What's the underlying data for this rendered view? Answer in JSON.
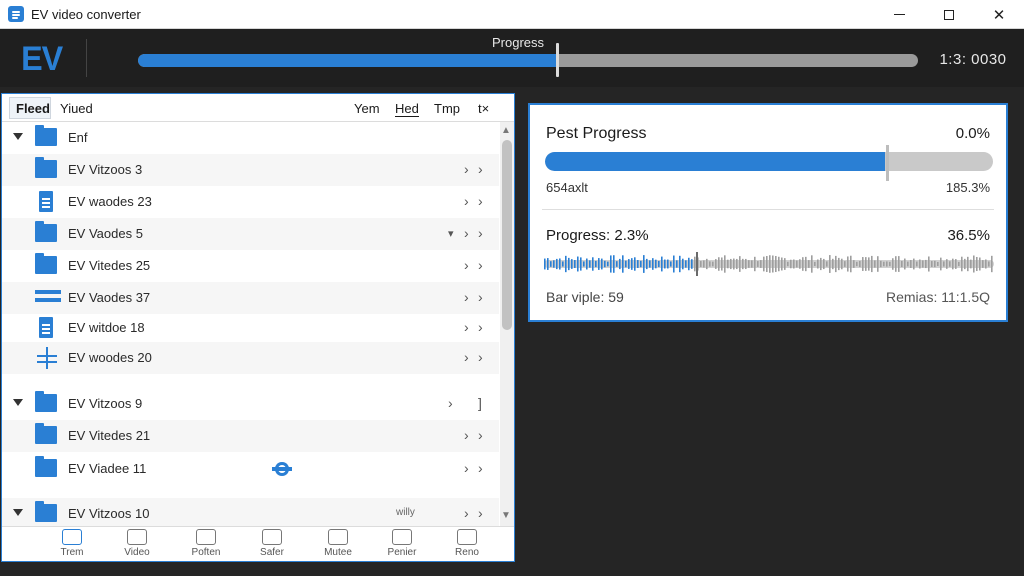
{
  "window": {
    "title": "EV video converter",
    "close_glyph": "✕"
  },
  "header": {
    "logo": "EV",
    "progress_label": "Progress",
    "progress_fraction": 0.537,
    "time_readout": "1:3: 0030"
  },
  "left_panel": {
    "tabs": [
      {
        "label": "Fleed",
        "active": true
      },
      {
        "label": "Yiued",
        "active": false
      }
    ],
    "columns": [
      "Yem",
      "Hed",
      "Tmp",
      "t×"
    ],
    "rows": [
      {
        "label": "Enf",
        "icon": "folder-icon",
        "expanded": true
      },
      {
        "label": "EV Vitzoos 3",
        "icon": "folder-icon"
      },
      {
        "label": "EV waodes 23",
        "icon": "document-icon"
      },
      {
        "label": "EV Vaodes 5",
        "icon": "folder-icon",
        "extra": "▾"
      },
      {
        "label": "EV Vitedes 25",
        "icon": "folder-icon"
      },
      {
        "label": "EV Vaodes 37",
        "icon": "bars-icon"
      },
      {
        "label": "EV witdoe 18",
        "icon": "document-icon"
      },
      {
        "label": "EV woodes 20",
        "icon": "cross-icon"
      },
      {
        "label": "EV Vitzoos 9",
        "icon": "folder-icon",
        "expanded": true
      },
      {
        "label": "EV Vitedes 21",
        "icon": "folder-icon"
      },
      {
        "label": "EV Viadee 11",
        "icon": "folder-icon",
        "badge": "gear-icon"
      },
      {
        "label": "EV Vitzoos 10",
        "icon": "folder-icon",
        "expanded": true,
        "note": "willy"
      }
    ],
    "bottom_bar": [
      {
        "label": "Trem",
        "icon": "convert-icon"
      },
      {
        "label": "Video",
        "icon": "video-icon"
      },
      {
        "label": "Poften",
        "icon": "folder-icon"
      },
      {
        "label": "Safer",
        "icon": "save-icon"
      },
      {
        "label": "Mutee",
        "icon": "file-icon"
      },
      {
        "label": "Penier",
        "icon": "pen-icon"
      },
      {
        "label": "Reno",
        "icon": "rename-icon"
      }
    ]
  },
  "right_panel": {
    "title": "Pest Progress",
    "percent_primary": "0.0%",
    "bar_fraction": 0.76,
    "stat_left": "654axlt",
    "stat_right": "185.3%",
    "progress_label": "Progress: 2.3%",
    "percent_secondary": "36.5%",
    "bar_viple": "Bar viple: 59",
    "remaining": "Remias: 11:1.5Q"
  },
  "colors": {
    "accent": "#2a7fd4",
    "dark_bg": "#252525"
  }
}
